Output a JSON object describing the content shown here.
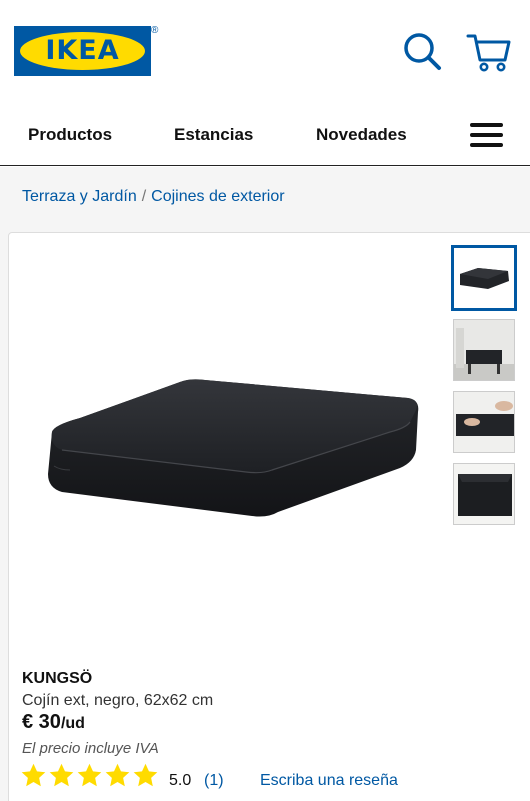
{
  "header": {
    "logo_text": "IKEA",
    "registered": "®"
  },
  "nav": {
    "items": [
      "Productos",
      "Estancias",
      "Novedades"
    ]
  },
  "breadcrumb": {
    "items": [
      "Terraza y Jardín",
      "Cojines de exterior"
    ],
    "separator": "/"
  },
  "product": {
    "name": "KUNGSÖ",
    "description": "Cojín ext, negro, 62x62 cm",
    "price": "€ 30",
    "unit": "/ud",
    "vat_note": "El precio incluye IVA",
    "rating_value": "5.0",
    "rating_count": "(1)",
    "review_link": "Escriba una reseña",
    "stars": 5
  },
  "colors": {
    "brand_blue": "#0058a3",
    "brand_yellow": "#ffdb00",
    "star_yellow": "#ffdb00",
    "cushion": "#222428"
  }
}
